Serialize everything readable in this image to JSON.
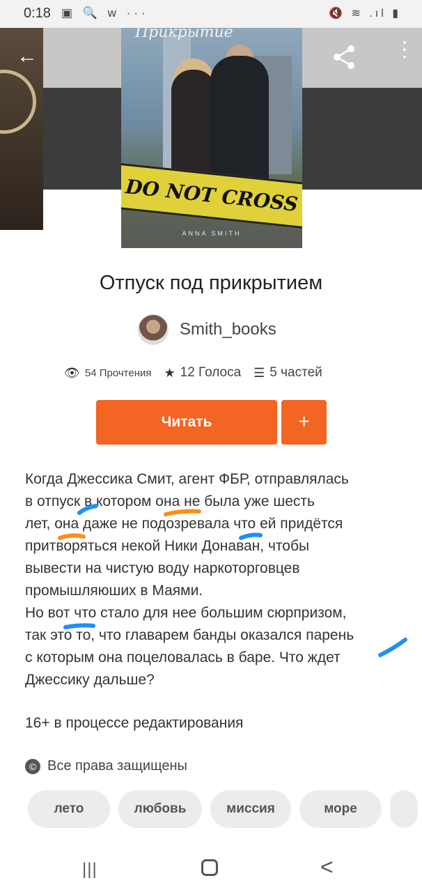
{
  "status_bar": {
    "time": "0:18",
    "left_icons": "▣ 🔍 w ···",
    "right_icons": "🔇 ≋ .ıl ▮"
  },
  "header": {
    "back_icon": "arrow-left-icon",
    "share_icon": "share-icon",
    "more_icon": "more-vertical-icon"
  },
  "cover": {
    "top_title": "Прикрытие",
    "tape_text": "DO NOT CROSS",
    "author_text": "ANNA SMITH"
  },
  "book": {
    "title": "Отпуск под прикрытием",
    "author": "Smith_books"
  },
  "stats": {
    "reads": "54 Прочтения",
    "votes": "12 Голоса",
    "parts": "5 частей"
  },
  "actions": {
    "read_label": "Читать",
    "add_label": "+"
  },
  "description": {
    "lines": [
      "Когда Джессика Смит, агент ФБР, отправлялась",
      "в отпуск в котором она не была уже шесть",
      "лет, она даже не подозревала что ей придётся",
      "притворяться некой Ники Донаван, чтобы",
      "вывести на чистую воду наркоторговцев",
      "промышляюших в Маями.",
      "Но вот что стало для нее большим сюрпризом,",
      "так это то, что главарем банды оказался парень",
      "с которым она поцеловалась в баре. Что ждет",
      "Джессику дальше?"
    ]
  },
  "age_note": "16+ в процессе редактирования",
  "copyright": "Все права защищены",
  "tags": [
    "лето",
    "любовь",
    "миссия",
    "море"
  ],
  "annotation_colors": {
    "blue": "#1e8fff",
    "orange": "#ff8c1a"
  },
  "colors": {
    "accent": "#f26522"
  },
  "nav": {
    "recent": "|||",
    "back": "<"
  }
}
